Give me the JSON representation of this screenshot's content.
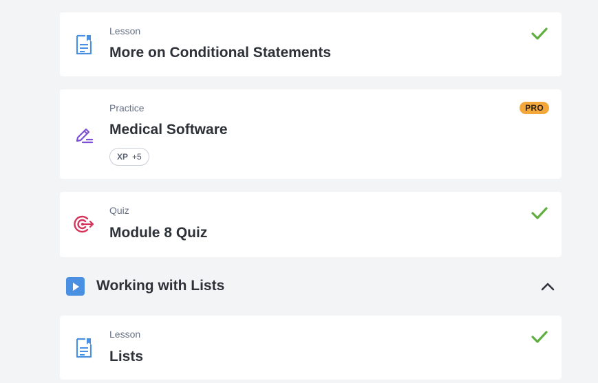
{
  "items": [
    {
      "kind": "Lesson",
      "title": "More on Conditional Statements",
      "icon": "lesson-doc-icon",
      "status": "completed"
    },
    {
      "kind": "Practice",
      "title": "Medical Software",
      "icon": "practice-pencil-icon",
      "badge": "PRO",
      "xp_label": "XP",
      "xp_value": "+5"
    },
    {
      "kind": "Quiz",
      "title": "Module 8 Quiz",
      "icon": "quiz-target-icon",
      "status": "completed"
    }
  ],
  "section": {
    "title": "Working with Lists",
    "expanded": true
  },
  "section_items": [
    {
      "kind": "Lesson",
      "title": "Lists",
      "icon": "lesson-doc-icon",
      "status": "completed"
    }
  ],
  "colors": {
    "background": "#f3f4f6",
    "check": "#5fae3f",
    "lesson_icon": "#4a90e2",
    "practice_icon": "#7b4fd6",
    "quiz_icon": "#d6335b",
    "pro_badge": "#f4a73b",
    "section_play": "#4a90e2"
  }
}
